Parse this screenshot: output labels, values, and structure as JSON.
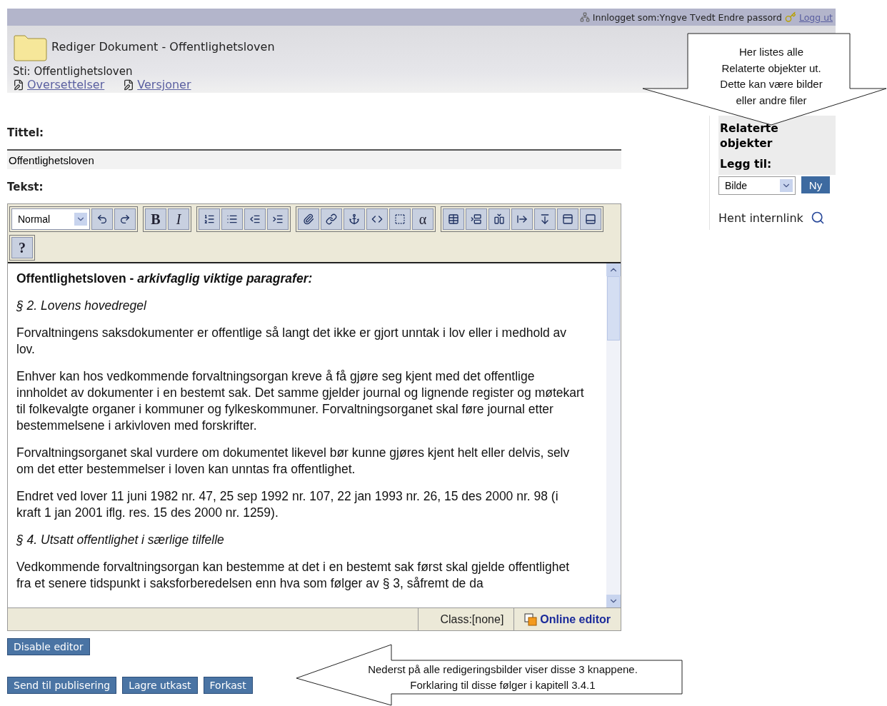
{
  "top_bar": {
    "user": "Innlogget som:Yngve Tvedt",
    "change_password": "Endre passord",
    "logout": "Logg ut"
  },
  "header": {
    "title": "Rediger Dokument - Offentlighetsloven",
    "path": "Sti: Offentlighetsloven",
    "links": [
      "Oversettelser",
      "Versjoner"
    ]
  },
  "title_field": {
    "label": "Tittel:",
    "value": "Offentlighetsloven"
  },
  "text_label": "Tekst:",
  "toolbar": {
    "groups": [
      {
        "items": [
          {
            "kind": "select",
            "value": "Normal"
          },
          {
            "kind": "icon"
          },
          {
            "kind": "icon"
          }
        ]
      },
      {
        "items": [
          {
            "kind": "bold",
            "label": "B"
          },
          {
            "kind": "italic",
            "label": "I"
          }
        ]
      },
      {
        "items": [
          {
            "kind": "icon"
          },
          {
            "kind": "icon"
          },
          {
            "kind": "icon"
          },
          {
            "kind": "icon"
          }
        ]
      },
      {
        "items": [
          {
            "kind": "icon"
          },
          {
            "kind": "icon"
          },
          {
            "kind": "icon"
          },
          {
            "kind": "icon"
          },
          {
            "kind": "icon"
          },
          {
            "kind": "symbol",
            "label": "α"
          }
        ]
      },
      {
        "items": [
          {
            "kind": "icon"
          },
          {
            "kind": "icon"
          },
          {
            "kind": "icon"
          },
          {
            "kind": "icon"
          },
          {
            "kind": "icon"
          },
          {
            "kind": "icon"
          },
          {
            "kind": "icon"
          }
        ]
      },
      {
        "items": [
          {
            "kind": "bold",
            "label": "?"
          }
        ]
      }
    ]
  },
  "content": [
    {
      "kind": "heading",
      "text": "Offentlighetsloven - *arkivfaglig viktige paragrafer:*"
    },
    {
      "kind": "section",
      "text": "§ 2. Lovens hovedregel"
    },
    {
      "kind": "body",
      "text": "Forvaltningens saksdokumenter er offentlige så langt det ikke er gjort unntak i lov eller i medhold av lov."
    },
    {
      "kind": "body",
      "text": "Enhver kan hos vedkommende forvaltningsorgan kreve å få gjøre seg kjent med det offentlige innholdet av dokumenter i en bestemt sak. Det samme gjelder journal og lignende register og møtekart til folkevalgte organer i kommuner og fylkeskommuner. Forvaltningsorganet skal føre journal etter bestemmelsene i arkivloven med forskrifter."
    },
    {
      "kind": "body",
      "text": "Forvaltningsorganet skal vurdere om dokumentet likevel bør kunne gjøres kjent helt eller delvis, selv om det etter bestemmelser i loven kan unntas fra offentlighet."
    },
    {
      "kind": "body",
      "text": "Endret ved lover 11 juni 1982 nr. 47, 25 sep 1992 nr. 107, 22 jan 1993 nr. 26, 15 des 2000 nr. 98 (i kraft 1 jan 2001 iflg. res. 15 des 2000 nr. 1259)."
    },
    {
      "kind": "section",
      "text": "§ 4. Utsatt offentlighet i særlige tilfelle"
    },
    {
      "kind": "body",
      "text": "Vedkommende forvaltningsorgan kan bestemme at det i en bestemt sak først skal gjelde offentlighet fra et senere tidspunkt i saksforberedelsen enn hva som følger av § 3, såfremt de da"
    }
  ],
  "status_bar": {
    "class": "Class:[none]",
    "mode": "Online editor"
  },
  "disable_button": "Disable editor",
  "actions": [
    "Send til publisering",
    "Lagre utkast",
    "Forkast"
  ],
  "sidebar": {
    "title": "Relaterte objekter",
    "add_label": "Legg til:",
    "type_select": "Bilde",
    "new_button": "Ny",
    "internal_link": "Hent internlink"
  },
  "callouts": [
    {
      "kind": "down",
      "text": "Her listes alle Relaterte objekter ut. Dette kan være bilder eller andre filer"
    },
    {
      "kind": "left",
      "text": "Nederst på alle redigeringsbilder viser disse 3 knappene. Forklaring til disse følger i kapitell 3.4.1"
    }
  ]
}
